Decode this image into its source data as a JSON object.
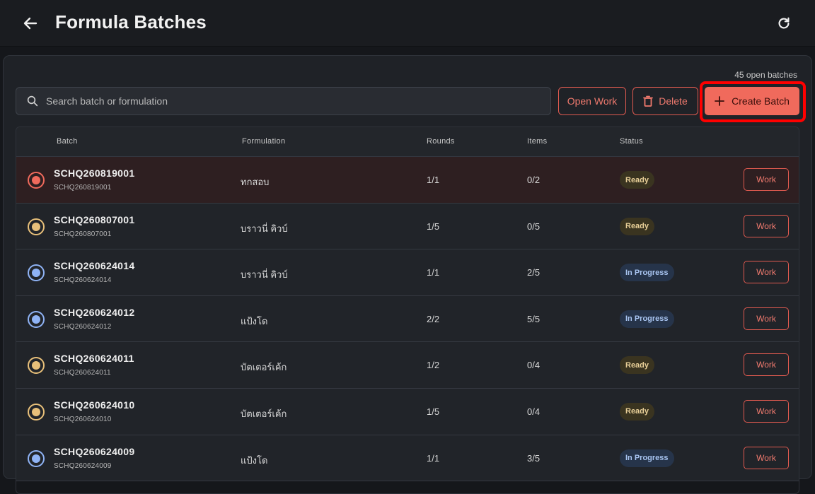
{
  "header": {
    "title": "Formula Batches"
  },
  "toolbar": {
    "open_batches_count": "45 open batches",
    "search_placeholder": "Search batch or formulation",
    "open_work_label": "Open Work",
    "delete_label": "Delete",
    "create_batch_label": "Create Batch"
  },
  "table": {
    "columns": {
      "batch": "Batch",
      "formulation": "Formulation",
      "rounds": "Rounds",
      "items": "Items",
      "status": "Status"
    },
    "work_label": "Work",
    "rows": [
      {
        "batch": "SCHQ260819001",
        "batch_sub": "SCHQ260819001",
        "formulation": "ทกสอบ",
        "rounds": "1/1",
        "items": "0/2",
        "status": "Ready",
        "selected": true
      },
      {
        "batch": "SCHQ260807001",
        "batch_sub": "SCHQ260807001",
        "formulation": "บราวนี่ คิวบ์",
        "rounds": "1/5",
        "items": "0/5",
        "status": "Ready",
        "selected": false
      },
      {
        "batch": "SCHQ260624014",
        "batch_sub": "SCHQ260624014",
        "formulation": "บราวนี่ คิวบ์",
        "rounds": "1/1",
        "items": "2/5",
        "status": "In Progress",
        "selected": false
      },
      {
        "batch": "SCHQ260624012",
        "batch_sub": "SCHQ260624012",
        "formulation": "แป้งโด",
        "rounds": "2/2",
        "items": "5/5",
        "status": "In Progress",
        "selected": false
      },
      {
        "batch": "SCHQ260624011",
        "batch_sub": "SCHQ260624011",
        "formulation": "บัตเตอร์เค้ก",
        "rounds": "1/2",
        "items": "0/4",
        "status": "Ready",
        "selected": false
      },
      {
        "batch": "SCHQ260624010",
        "batch_sub": "SCHQ260624010",
        "formulation": "บัตเตอร์เค้ก",
        "rounds": "1/5",
        "items": "0/4",
        "status": "Ready",
        "selected": false
      },
      {
        "batch": "SCHQ260624009",
        "batch_sub": "SCHQ260624009",
        "formulation": "แป้งโด",
        "rounds": "1/1",
        "items": "3/5",
        "status": "In Progress",
        "selected": false
      }
    ]
  },
  "colors": {
    "accent": "#f06a5c",
    "ready_radio": "#e8c07a",
    "progress_radio": "#8fb3f5",
    "selected_radio": "#f06a5c"
  },
  "icons": {
    "back": "arrow-left-icon",
    "refresh": "refresh-icon",
    "search": "search-icon",
    "delete": "trash-icon",
    "create": "plus-icon"
  }
}
